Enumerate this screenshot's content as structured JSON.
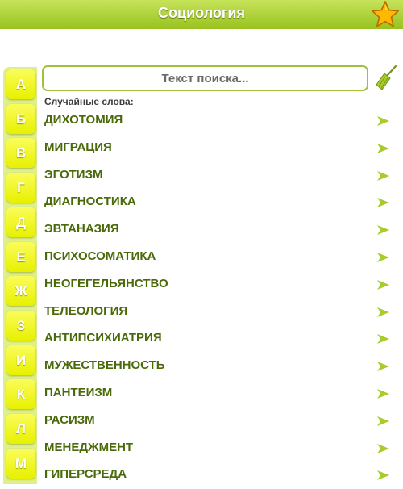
{
  "header": {
    "title": "Социология",
    "favorite_icon": "star-icon",
    "colors": {
      "bar_top": "#c7e35a",
      "bar_bottom": "#98c21f",
      "star": "#ffb800"
    }
  },
  "alphabet": [
    "А",
    "Б",
    "В",
    "Г",
    "Д",
    "Е",
    "Ж",
    "З",
    "И",
    "К",
    "Л",
    "М"
  ],
  "search": {
    "placeholder": "Текст поиска...",
    "value": "",
    "clear_icon": "broom-icon"
  },
  "random_words": {
    "label": "Случайные слова:",
    "row_icon": "arrow-right-icon",
    "items": [
      "ДИХОТОМИЯ",
      "МИГРАЦИЯ",
      "ЭГОТИЗМ",
      "ДИАГНОСТИКА",
      "ЭВТАНАЗИЯ",
      "ПСИХОСОМАТИКА",
      "НЕОГЕГЕЛЬЯНСТВО",
      "ТЕЛЕОЛОГИЯ",
      "АНТИПСИХИАТРИЯ",
      "МУЖЕСТВЕННОСТЬ",
      "ПАНТЕИЗМ",
      "РАСИЗМ",
      "МЕНЕДЖМЕНТ",
      "ГИПЕРСРЕДА"
    ]
  },
  "colors": {
    "accent_green": "#98c21f",
    "word_text": "#4a6a0a",
    "letter_key": "#e7f000"
  }
}
